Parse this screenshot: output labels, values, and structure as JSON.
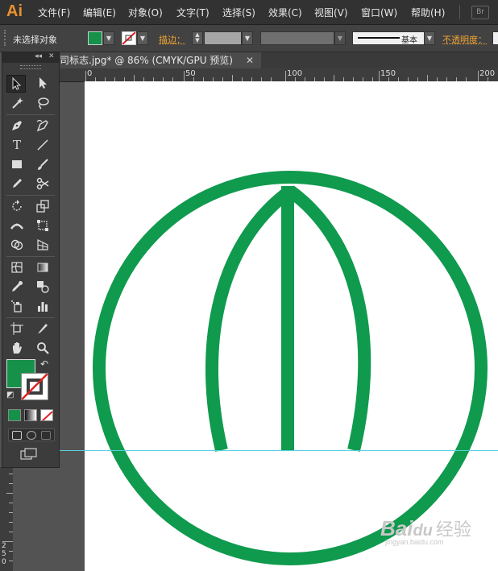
{
  "app": {
    "logo": "Ai",
    "bridge_badge": "Br"
  },
  "menu": [
    "文件(F)",
    "编辑(E)",
    "对象(O)",
    "文字(T)",
    "选择(S)",
    "效果(C)",
    "视图(V)",
    "窗口(W)",
    "帮助(H)"
  ],
  "control": {
    "selection": "未选择对象",
    "stroke_label": "描边：",
    "stroke_style": "基本",
    "opacity_label": "不透明度：",
    "fill_color": "#16914a"
  },
  "document": {
    "tab_title": "司标志.jpg* @ 86% (CMYK/GPU 预览)",
    "close": "✕"
  },
  "ruler": {
    "h": [
      "0",
      "50",
      "100",
      "150",
      "200"
    ],
    "v": [
      "2",
      "5",
      "0"
    ]
  },
  "toolbox": {
    "collapse": "◂◂",
    "close": "✕",
    "swap": "↶",
    "reset": "◩"
  },
  "logo_art": {
    "color": "#0f9a4e"
  },
  "guide_color": "#57d1e3",
  "watermark": {
    "brand": "Bai",
    "paw": "du",
    "cn": "经验",
    "url": "jingyan.baidu.com"
  }
}
